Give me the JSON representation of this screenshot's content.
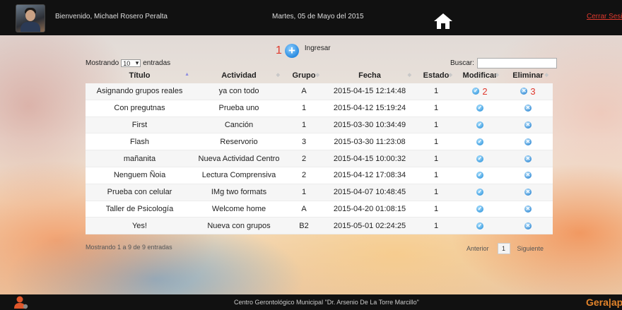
{
  "header": {
    "welcome": "Bienvenido, Michael Rosero Peralta",
    "date": "Martes, 05 de Mayo del 2015",
    "logout": "Cerrar Sesión"
  },
  "toolbar": {
    "marker_add": "1",
    "add_label": "Ingresar",
    "show_prefix": "Mostrando",
    "page_size": "10",
    "show_suffix": "entradas",
    "search_label": "Buscar:",
    "search_value": ""
  },
  "table": {
    "columns": [
      "Título",
      "Actividad",
      "Grupo",
      "Fecha",
      "Estado",
      "Modificar",
      "Eliminar"
    ],
    "rows": [
      [
        "Asignando grupos reales",
        "ya con todo",
        "A",
        "2015-04-15 12:14:48",
        "1"
      ],
      [
        "Con pregutnas",
        "Prueba uno",
        "1",
        "2015-04-12 15:19:24",
        "1"
      ],
      [
        "First",
        "Canción",
        "1",
        "2015-03-30 10:34:49",
        "1"
      ],
      [
        "Flash",
        "Reservorio",
        "3",
        "2015-03-30 11:23:08",
        "1"
      ],
      [
        "mañanita",
        "Nueva Actividad Centro",
        "2",
        "2015-04-15 10:00:32",
        "1"
      ],
      [
        "Nenguem Ñoia",
        "Lectura Comprensiva",
        "2",
        "2015-04-12 17:08:34",
        "1"
      ],
      [
        "Prueba con celular",
        "IMg two formats",
        "1",
        "2015-04-07 10:48:45",
        "1"
      ],
      [
        "Taller de Psicología",
        "Welcome home",
        "A",
        "2015-04-20 01:08:15",
        "1"
      ],
      [
        "Yes!",
        "Nueva con grupos",
        "B2",
        "2015-05-01 02:24:25",
        "1"
      ]
    ],
    "marker_edit": "2",
    "marker_delete": "3"
  },
  "pagination": {
    "info": "Mostrando 1 a 9 de 9 entradas",
    "previous": "Anterior",
    "page": "1",
    "next": "Siguiente"
  },
  "footer": {
    "text": "Centro Gerontológico Municipal \"Dr. Arsenio De La Torre Marcillo\"",
    "logo": "Gera|ap"
  },
  "icons": {
    "home": "home-icon",
    "add": "plus-circle-icon",
    "edit": "check-circle-icon",
    "delete": "x-circle-icon",
    "user": "user-icon"
  },
  "colors": {
    "marker_red": "#e03a2e",
    "icon_blue": "#3d9de0",
    "logo_orange": "#e2832a"
  }
}
